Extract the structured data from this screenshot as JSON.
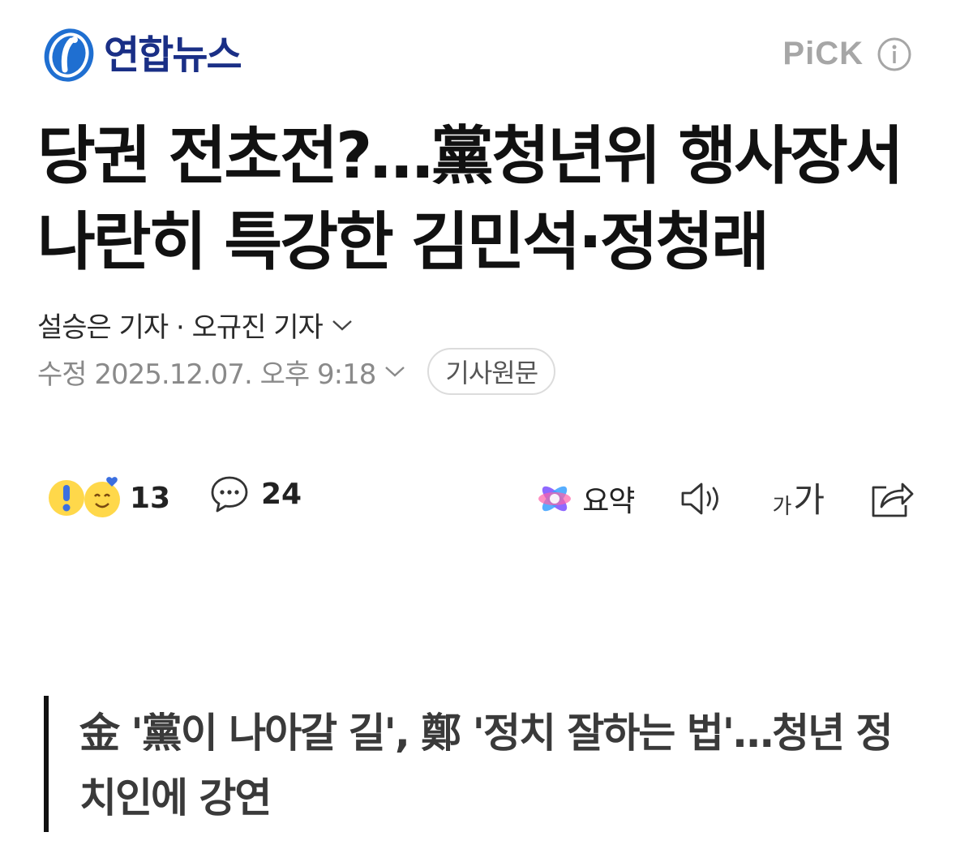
{
  "header": {
    "logo_text": "연합뉴스",
    "logo_icon": "yonhap-logo-icon",
    "pick_label": "PiCK",
    "info_icon": "info-icon",
    "brand_color": "#1a2f86"
  },
  "article": {
    "headline": "당권 전초전?…黨청년위 행사장서 나란히 특강한 김민석·정청래",
    "reporters": "설승은 기자 · 오규진 기자",
    "modified": "수정 2025.12.07. 오후 9:18",
    "original_button": "기사원문",
    "subheadline": "金 '黨이 나아갈 길', 鄭 '정치 잘하는 법'…청년 정치인에 강연"
  },
  "toolbar": {
    "reaction_count": "13",
    "comment_count": "24",
    "summary_label": "요약",
    "font_small": "가",
    "font_big": "가",
    "icons": [
      "reaction-emoji-icon",
      "comment-icon",
      "ai-summary-icon",
      "speaker-icon",
      "font-size-icon",
      "share-icon"
    ]
  }
}
